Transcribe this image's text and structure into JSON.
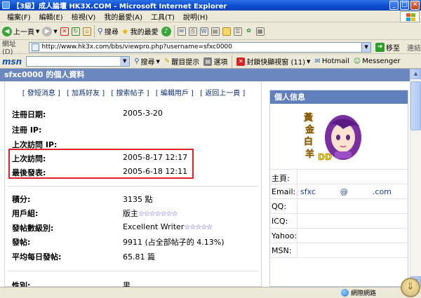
{
  "window": {
    "title": "【3級】成人論壇 HK3X.COM - Microsoft Internet Explorer",
    "minimize": "_",
    "maximize": "□",
    "close": "✕"
  },
  "menu": [
    "檔案(F)",
    "編輯(E)",
    "檢視(V)",
    "我的最愛(A)",
    "工具(T)",
    "說明(H)"
  ],
  "toolbar": {
    "back_label": "上一頁",
    "search_label": "搜尋",
    "favorites_label": "我的最愛"
  },
  "address": {
    "label": "網址(D)",
    "url": "http://www.hk3x.com/bbs/viewpro.php?username=sfxc0000",
    "go_label": "移至",
    "links_label": "連結"
  },
  "msn": {
    "logo": "msn",
    "search_label": "搜尋",
    "highlight_label": "醒目提示",
    "options_label": "選項",
    "popup_label": "封鎖快顯視窗 (11)",
    "hotmail_label": "Hotmail",
    "messenger_label": "Messenger"
  },
  "profile": {
    "heading": "sfxc0000 的個人資料",
    "actions": [
      "[ 發短消息 ]",
      "[ 加爲好友 ]",
      "[ 搜索帖子 ]",
      "[ 編輯用戶 ]",
      "[ 返回上一頁 ]"
    ],
    "fields_group1": [
      {
        "label": "注冊日期:",
        "value": "2005-3-20"
      },
      {
        "label": "注冊 IP:",
        "value": ""
      },
      {
        "label": "上次訪問 IP:",
        "value": ""
      },
      {
        "label": "上次訪問:",
        "value": "2005-8-17 12:17"
      },
      {
        "label": "最後發表:",
        "value": "2005-6-18 12:11"
      }
    ],
    "fields_group2": [
      {
        "label": "積分:",
        "value": "3135 點",
        "stars": ""
      },
      {
        "label": "用戶組:",
        "value": "版主",
        "stars": "☆☆☆☆☆☆☆"
      },
      {
        "label": "發帖數級別:",
        "value": "Excellent Writer",
        "stars": "☆☆☆☆☆"
      },
      {
        "label": "發帖:",
        "value": "9911 (占全部帖子的 4.13%)",
        "stars": ""
      },
      {
        "label": "平均每日發帖:",
        "value": "65.81 篇",
        "stars": ""
      }
    ],
    "gender": {
      "label": "性別:",
      "value": "男"
    }
  },
  "sidebar": {
    "title": "個人信息",
    "avatar_text": [
      "黃",
      "金",
      "白",
      "羊",
      "DD"
    ],
    "rows": [
      {
        "label": "主頁:",
        "value": ""
      },
      {
        "label": "Email:",
        "value": "sfxc          @          .com"
      },
      {
        "label": "QQ:",
        "value": ""
      },
      {
        "label": "ICQ:",
        "value": ""
      },
      {
        "label": "Yahoo:",
        "value": ""
      },
      {
        "label": "MSN:",
        "value": ""
      }
    ]
  },
  "status": {
    "zone": "網際網路"
  },
  "colors": {
    "title_blue": "#0a4bd0",
    "header_blue": "#5f7fbd",
    "highlight_red": "#e0202a",
    "star_blue": "#3a3ad8"
  }
}
